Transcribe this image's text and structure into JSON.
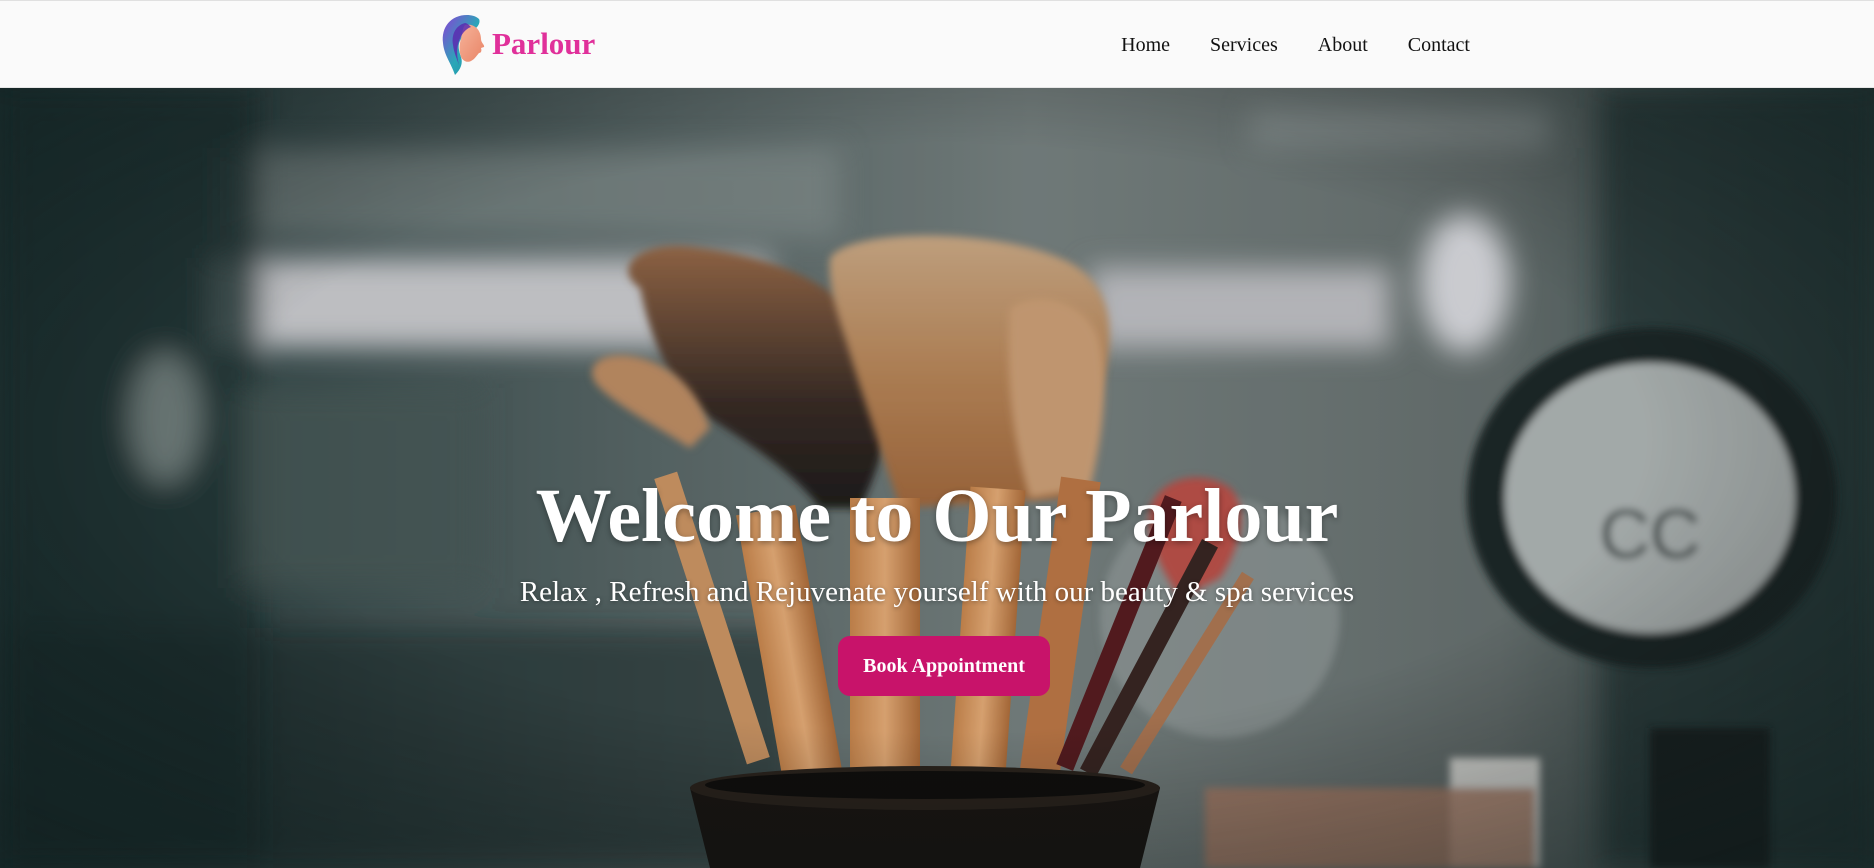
{
  "brand": {
    "name": "Parlour",
    "logo_icon": "woman-profile-icon",
    "color": "#e0309a"
  },
  "nav": {
    "items": [
      {
        "label": "Home"
      },
      {
        "label": "Services"
      },
      {
        "label": "About"
      },
      {
        "label": "Contact"
      }
    ]
  },
  "hero": {
    "title": "Welcome to Our Parlour",
    "subtitle": "Relax , Refresh and Rejuvenate yourself with our beauty & spa services",
    "cta_label": "Book Appointment",
    "cta_color": "#c8136a",
    "background_image": "makeup-brushes-photo"
  }
}
